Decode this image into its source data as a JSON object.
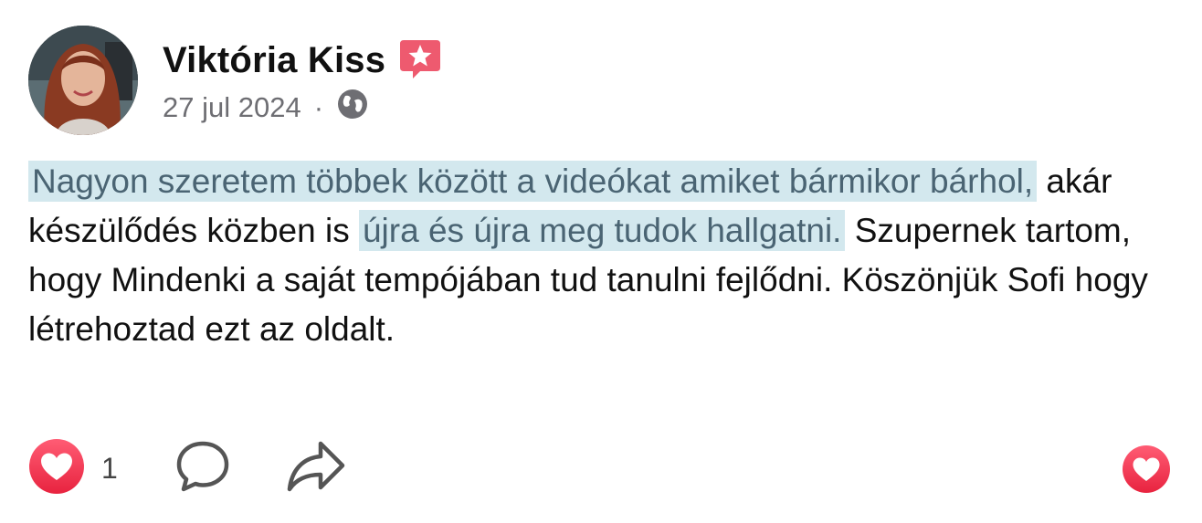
{
  "author": {
    "name": "Viktória Kiss",
    "badge_icon": "star-badge-icon",
    "badge_color": "#ee5a6f"
  },
  "meta": {
    "date": "27 jul 2024",
    "separator": "·",
    "audience_icon": "globe-icon"
  },
  "post": {
    "segments": [
      {
        "text": "Nagyon szeretem többek között  a videókat amiket bármikor bárhol,",
        "highlighted": true
      },
      {
        "text": " akár készülődés közben is ",
        "highlighted": false
      },
      {
        "text": "újra és újra meg tudok hallgatni.",
        "highlighted": true
      },
      {
        "text": " Szupernek tartom, hogy Mindenki a saját tempójában tud tanulni fejlődni. Köszönjük Sofi hogy létrehoztad ezt az oldalt.",
        "highlighted": false
      }
    ],
    "highlight_color": "#d3e8ee"
  },
  "actions": {
    "like_count": "1",
    "like_icon": "heart-icon",
    "comment_icon": "comment-icon",
    "share_icon": "share-icon",
    "reaction_icon": "heart-reaction-icon",
    "like_color": "#ee3a57"
  }
}
